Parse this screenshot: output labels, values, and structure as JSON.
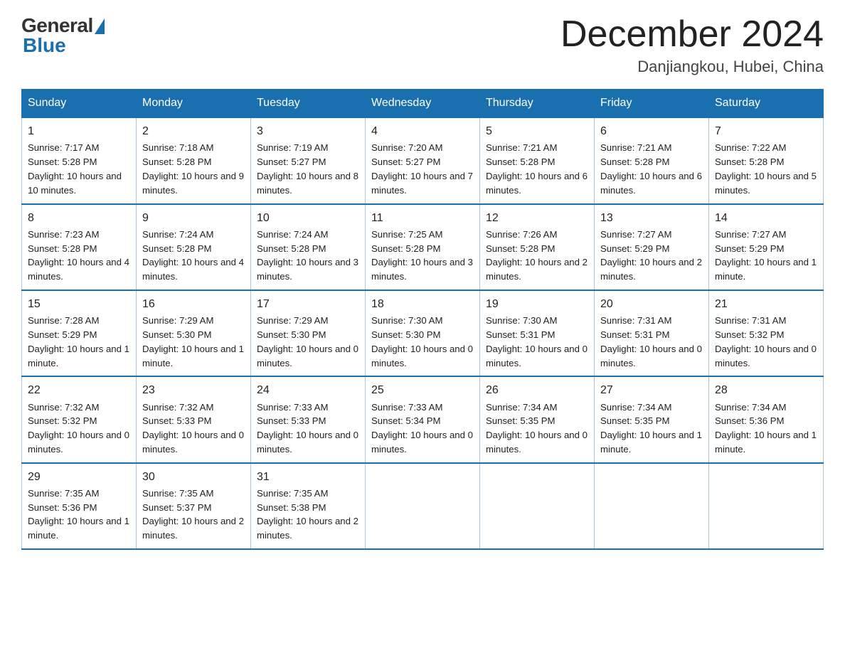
{
  "logo": {
    "general": "General",
    "blue": "Blue"
  },
  "header": {
    "month": "December 2024",
    "location": "Danjiangkou, Hubei, China"
  },
  "weekdays": [
    "Sunday",
    "Monday",
    "Tuesday",
    "Wednesday",
    "Thursday",
    "Friday",
    "Saturday"
  ],
  "weeks": [
    [
      {
        "day": "1",
        "sunrise": "7:17 AM",
        "sunset": "5:28 PM",
        "daylight": "10 hours and 10 minutes."
      },
      {
        "day": "2",
        "sunrise": "7:18 AM",
        "sunset": "5:28 PM",
        "daylight": "10 hours and 9 minutes."
      },
      {
        "day": "3",
        "sunrise": "7:19 AM",
        "sunset": "5:27 PM",
        "daylight": "10 hours and 8 minutes."
      },
      {
        "day": "4",
        "sunrise": "7:20 AM",
        "sunset": "5:27 PM",
        "daylight": "10 hours and 7 minutes."
      },
      {
        "day": "5",
        "sunrise": "7:21 AM",
        "sunset": "5:28 PM",
        "daylight": "10 hours and 6 minutes."
      },
      {
        "day": "6",
        "sunrise": "7:21 AM",
        "sunset": "5:28 PM",
        "daylight": "10 hours and 6 minutes."
      },
      {
        "day": "7",
        "sunrise": "7:22 AM",
        "sunset": "5:28 PM",
        "daylight": "10 hours and 5 minutes."
      }
    ],
    [
      {
        "day": "8",
        "sunrise": "7:23 AM",
        "sunset": "5:28 PM",
        "daylight": "10 hours and 4 minutes."
      },
      {
        "day": "9",
        "sunrise": "7:24 AM",
        "sunset": "5:28 PM",
        "daylight": "10 hours and 4 minutes."
      },
      {
        "day": "10",
        "sunrise": "7:24 AM",
        "sunset": "5:28 PM",
        "daylight": "10 hours and 3 minutes."
      },
      {
        "day": "11",
        "sunrise": "7:25 AM",
        "sunset": "5:28 PM",
        "daylight": "10 hours and 3 minutes."
      },
      {
        "day": "12",
        "sunrise": "7:26 AM",
        "sunset": "5:28 PM",
        "daylight": "10 hours and 2 minutes."
      },
      {
        "day": "13",
        "sunrise": "7:27 AM",
        "sunset": "5:29 PM",
        "daylight": "10 hours and 2 minutes."
      },
      {
        "day": "14",
        "sunrise": "7:27 AM",
        "sunset": "5:29 PM",
        "daylight": "10 hours and 1 minute."
      }
    ],
    [
      {
        "day": "15",
        "sunrise": "7:28 AM",
        "sunset": "5:29 PM",
        "daylight": "10 hours and 1 minute."
      },
      {
        "day": "16",
        "sunrise": "7:29 AM",
        "sunset": "5:30 PM",
        "daylight": "10 hours and 1 minute."
      },
      {
        "day": "17",
        "sunrise": "7:29 AM",
        "sunset": "5:30 PM",
        "daylight": "10 hours and 0 minutes."
      },
      {
        "day": "18",
        "sunrise": "7:30 AM",
        "sunset": "5:30 PM",
        "daylight": "10 hours and 0 minutes."
      },
      {
        "day": "19",
        "sunrise": "7:30 AM",
        "sunset": "5:31 PM",
        "daylight": "10 hours and 0 minutes."
      },
      {
        "day": "20",
        "sunrise": "7:31 AM",
        "sunset": "5:31 PM",
        "daylight": "10 hours and 0 minutes."
      },
      {
        "day": "21",
        "sunrise": "7:31 AM",
        "sunset": "5:32 PM",
        "daylight": "10 hours and 0 minutes."
      }
    ],
    [
      {
        "day": "22",
        "sunrise": "7:32 AM",
        "sunset": "5:32 PM",
        "daylight": "10 hours and 0 minutes."
      },
      {
        "day": "23",
        "sunrise": "7:32 AM",
        "sunset": "5:33 PM",
        "daylight": "10 hours and 0 minutes."
      },
      {
        "day": "24",
        "sunrise": "7:33 AM",
        "sunset": "5:33 PM",
        "daylight": "10 hours and 0 minutes."
      },
      {
        "day": "25",
        "sunrise": "7:33 AM",
        "sunset": "5:34 PM",
        "daylight": "10 hours and 0 minutes."
      },
      {
        "day": "26",
        "sunrise": "7:34 AM",
        "sunset": "5:35 PM",
        "daylight": "10 hours and 0 minutes."
      },
      {
        "day": "27",
        "sunrise": "7:34 AM",
        "sunset": "5:35 PM",
        "daylight": "10 hours and 1 minute."
      },
      {
        "day": "28",
        "sunrise": "7:34 AM",
        "sunset": "5:36 PM",
        "daylight": "10 hours and 1 minute."
      }
    ],
    [
      {
        "day": "29",
        "sunrise": "7:35 AM",
        "sunset": "5:36 PM",
        "daylight": "10 hours and 1 minute."
      },
      {
        "day": "30",
        "sunrise": "7:35 AM",
        "sunset": "5:37 PM",
        "daylight": "10 hours and 2 minutes."
      },
      {
        "day": "31",
        "sunrise": "7:35 AM",
        "sunset": "5:38 PM",
        "daylight": "10 hours and 2 minutes."
      },
      null,
      null,
      null,
      null
    ]
  ]
}
